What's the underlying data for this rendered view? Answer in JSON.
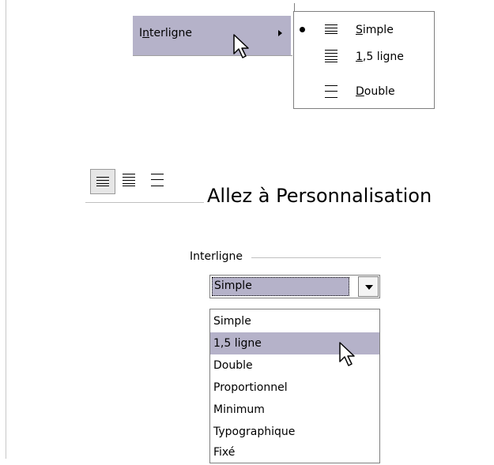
{
  "menu": {
    "item_label": "Interligne",
    "item_underline_char": "n",
    "submenu": [
      {
        "label": "Simple",
        "accel": "S",
        "selected": true,
        "icon": "line-spacing-single-icon"
      },
      {
        "label": "1,5 ligne",
        "accel": "1",
        "selected": false,
        "icon": "line-spacing-1-5-icon"
      },
      {
        "label": "Double",
        "accel": "D",
        "selected": false,
        "icon": "line-spacing-double-icon"
      }
    ]
  },
  "toolbar": {
    "buttons": [
      {
        "icon": "line-spacing-single-icon",
        "active": true
      },
      {
        "icon": "line-spacing-1-5-icon",
        "active": false
      },
      {
        "icon": "line-spacing-double-icon",
        "active": false
      }
    ],
    "caption": "Allez à Personnalisation"
  },
  "dialog": {
    "group_label": "Interligne",
    "combo_value": "Simple",
    "options": [
      "Simple",
      "1,5 ligne",
      "Double",
      "Proportionnel",
      "Minimum",
      "Typographique",
      "Fixé"
    ],
    "highlighted_index": 1
  },
  "colors": {
    "selection": "#b5b2c9",
    "border": "#7f7f7f"
  }
}
